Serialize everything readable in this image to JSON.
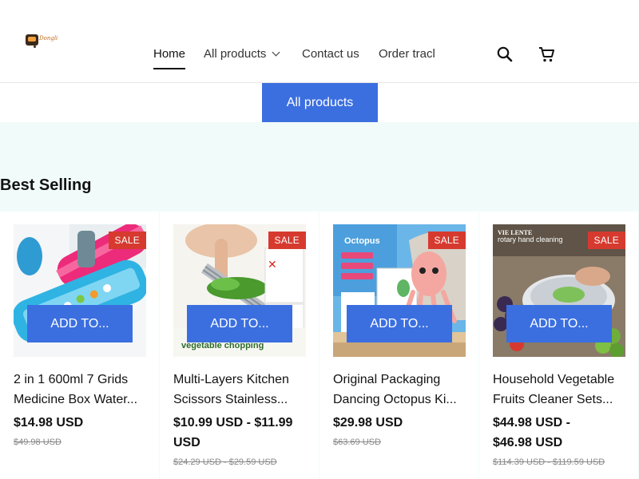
{
  "header": {
    "logo_text": "Dongli",
    "nav": [
      {
        "label": "Home",
        "active": true
      },
      {
        "label": "All products",
        "has_dropdown": true
      },
      {
        "label": "Contact us"
      },
      {
        "label": "Order tracl"
      }
    ],
    "search_icon": "search-icon",
    "cart_icon": "cart-icon"
  },
  "hero": {
    "button_label": "All products"
  },
  "section": {
    "title": "Best Selling"
  },
  "products": [
    {
      "title_line1": "2 in 1 600ml 7 Grids",
      "title_line2": "Medicine Box Water...",
      "price_line1": "$14.98 USD",
      "price_line2": "",
      "compare": "$49.98 USD",
      "badge": "SALE",
      "button": "ADD TO..."
    },
    {
      "title_line1": "Multi-Layers Kitchen",
      "title_line2": "Scissors Stainless...",
      "price_line1": "$10.99 USD - $11.99",
      "price_line2": "USD",
      "compare": "$24.29 USD - $29.59 USD",
      "badge": "SALE",
      "button": "ADD TO...",
      "image_caption": "vegetable chopping"
    },
    {
      "title_line1": "Original Packaging",
      "title_line2": "Dancing Octopus Ki...",
      "price_line1": "$29.98 USD",
      "price_line2": "",
      "compare": "$63.69 USD",
      "badge": "SALE",
      "button": "ADD TO...",
      "image_caption": "Octopus"
    },
    {
      "title_line1": "Household Vegetable",
      "title_line2": "Fruits Cleaner Sets...",
      "price_line1": "$44.98 USD -",
      "price_line2": "$46.98 USD",
      "compare": "$114.39 USD - $119.59 USD",
      "badge": "SALE",
      "button": "ADD TO...",
      "image_caption": "rotary hand cleaning"
    }
  ],
  "colors": {
    "accent": "#3b6fe0",
    "sale": "#d63a2f",
    "section_bg": "#f1fbfa"
  }
}
